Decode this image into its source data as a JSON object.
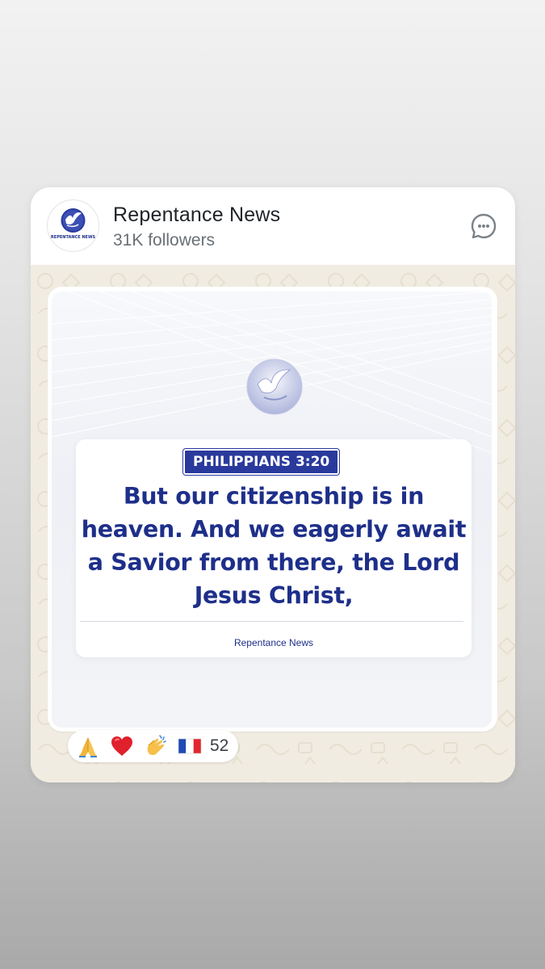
{
  "channel": {
    "name": "Repentance News",
    "followers": "31K followers",
    "avatar_caption": "REPENTANCE NEWS"
  },
  "post": {
    "reference": "PHILIPPIANS 3:20",
    "verse": "But our citizenship is in heaven. And we eagerly await a Savior from there, the Lord Jesus Christ,",
    "signature": "Repentance News"
  },
  "reactions": {
    "items": [
      {
        "name": "pray-emoji-icon"
      },
      {
        "name": "heart-emoji-icon"
      },
      {
        "name": "clap-emoji-icon"
      },
      {
        "name": "france-flag-icon"
      }
    ],
    "count": "52"
  },
  "icons": {
    "share": "share-channel-icon",
    "logo": "dove-logo-icon"
  },
  "colors": {
    "brand_blue": "#1e2f8a",
    "badge_blue": "#2a3a9c",
    "wallpaper": "#f1ece1",
    "header_text": "#1f2328",
    "muted_text": "#687076"
  }
}
